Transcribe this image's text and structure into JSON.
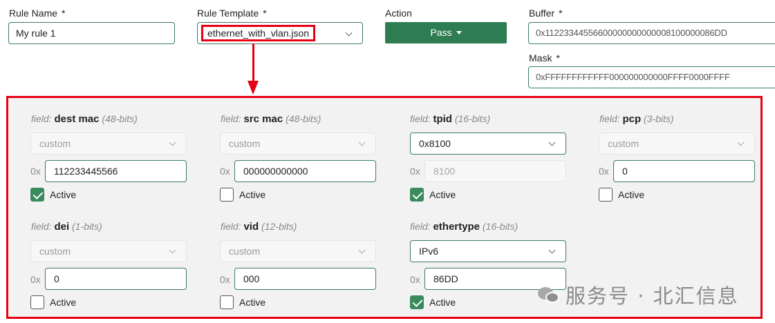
{
  "top": {
    "rule_name": {
      "label": "Rule Name",
      "required": "*",
      "value": "My rule 1"
    },
    "rule_template": {
      "label": "Rule Template",
      "required": "*",
      "value": "ethernet_with_vlan.json"
    },
    "action": {
      "label": "Action",
      "value": "Pass"
    },
    "buffer": {
      "label": "Buffer",
      "required": "*",
      "value": "0x11223344556600000000000008100000086DD"
    },
    "mask": {
      "label": "Mask",
      "required": "*",
      "value": "0xFFFFFFFFFFFF000000000000FFFF0000FFFF"
    }
  },
  "fields": {
    "prefix": "field:",
    "hex_prefix": "0x",
    "active_label": "Active",
    "dest_mac": {
      "name": "dest mac",
      "bits": "(48-bits)",
      "select": "custom",
      "value": "112233445566",
      "active": true
    },
    "src_mac": {
      "name": "src mac",
      "bits": "(48-bits)",
      "select": "custom",
      "value": "000000000000",
      "active": false
    },
    "tpid": {
      "name": "tpid",
      "bits": "(16-bits)",
      "select": "0x8100",
      "value": "8100",
      "active": true
    },
    "pcp": {
      "name": "pcp",
      "bits": "(3-bits)",
      "select": "custom",
      "value": "0",
      "active": false
    },
    "dei": {
      "name": "dei",
      "bits": "(1-bits)",
      "select": "custom",
      "value": "0",
      "active": false
    },
    "vid": {
      "name": "vid",
      "bits": "(12-bits)",
      "select": "custom",
      "value": "000",
      "active": false
    },
    "ethertype": {
      "name": "ethertype",
      "bits": "(16-bits)",
      "select": "IPv6",
      "value": "86DD",
      "active": true
    }
  },
  "watermark": {
    "text": "服务号 · 北汇信息",
    "icon": "wechat-icon"
  },
  "colors": {
    "accent": "#2e7d52",
    "highlight": "#e60012",
    "panel_bg": "#f2f2f2"
  }
}
